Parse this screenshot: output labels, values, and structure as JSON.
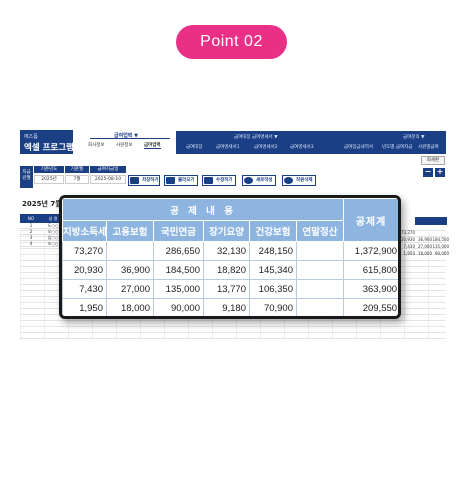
{
  "badge": {
    "label": "Point 02"
  },
  "background_app": {
    "logo_small": "에즈폼",
    "logo_title": "엑셀 프로그램",
    "menu_group1": {
      "header": "급여업력 ▼",
      "items": [
        "회사정보",
        "사원정보",
        "급여업력"
      ]
    },
    "menu_group2": {
      "row1": [
        "급여대장 급여명세서 ▼",
        "급여문의 ▼"
      ],
      "row2": [
        "급여대장",
        "급여명세서1",
        "급여명세서2",
        "급여명세서3",
        "급여업금내역서",
        "년도별 급여지급",
        "사원별급여"
      ]
    },
    "print_button": "회세판",
    "plus_button": "+",
    "minus_button": "−",
    "filters": [
      {
        "label": "기준년도",
        "value": "2025년"
      },
      {
        "label": "기준월",
        "value": "7월"
      },
      {
        "label": "급여지급일",
        "value": "2025-08-10"
      }
    ],
    "filter_side_label": "지급\n년월",
    "toolbar": [
      "저장하기",
      "불러오기",
      "수정하기",
      "새로작성",
      "작원삭제"
    ],
    "year_title": "2025년 7월",
    "left_table": {
      "headers": [
        "NO",
        "성 명"
      ],
      "rows": [
        [
          "1",
          "도○○"
        ],
        [
          "2",
          "오○○"
        ],
        [
          "3",
          "임○○"
        ],
        [
          "4",
          "조○○"
        ]
      ]
    },
    "right_values": [
      [
        "73,270",
        ""
      ],
      [
        "20,930",
        "36,900",
        "184,500"
      ],
      [
        "7,430",
        "27,000",
        "135,000"
      ],
      [
        "1,950",
        "18,000",
        "90,000"
      ]
    ]
  },
  "popup": {
    "group_header": "공 제 내 용",
    "total_header": "공제계",
    "columns": [
      "지방소득세",
      "고용보험",
      "국민연금",
      "장기요양",
      "건강보험",
      "연말정산"
    ],
    "rows": [
      {
        "cells": [
          "73,270",
          "",
          "286,650",
          "32,130",
          "248,150",
          ""
        ],
        "total": "1,372,900"
      },
      {
        "cells": [
          "20,930",
          "36,900",
          "184,500",
          "18,820",
          "145,340",
          ""
        ],
        "total": "615,800"
      },
      {
        "cells": [
          "7,430",
          "27,000",
          "135,000",
          "13,770",
          "106,350",
          ""
        ],
        "total": "363,900"
      },
      {
        "cells": [
          "1,950",
          "18,000",
          "90,000",
          "9,180",
          "70,900",
          ""
        ],
        "total": "209,550"
      }
    ]
  },
  "colors": {
    "badge": "#ea2f87",
    "navy": "#1b3f84",
    "header_blue": "#8eb4e0"
  }
}
